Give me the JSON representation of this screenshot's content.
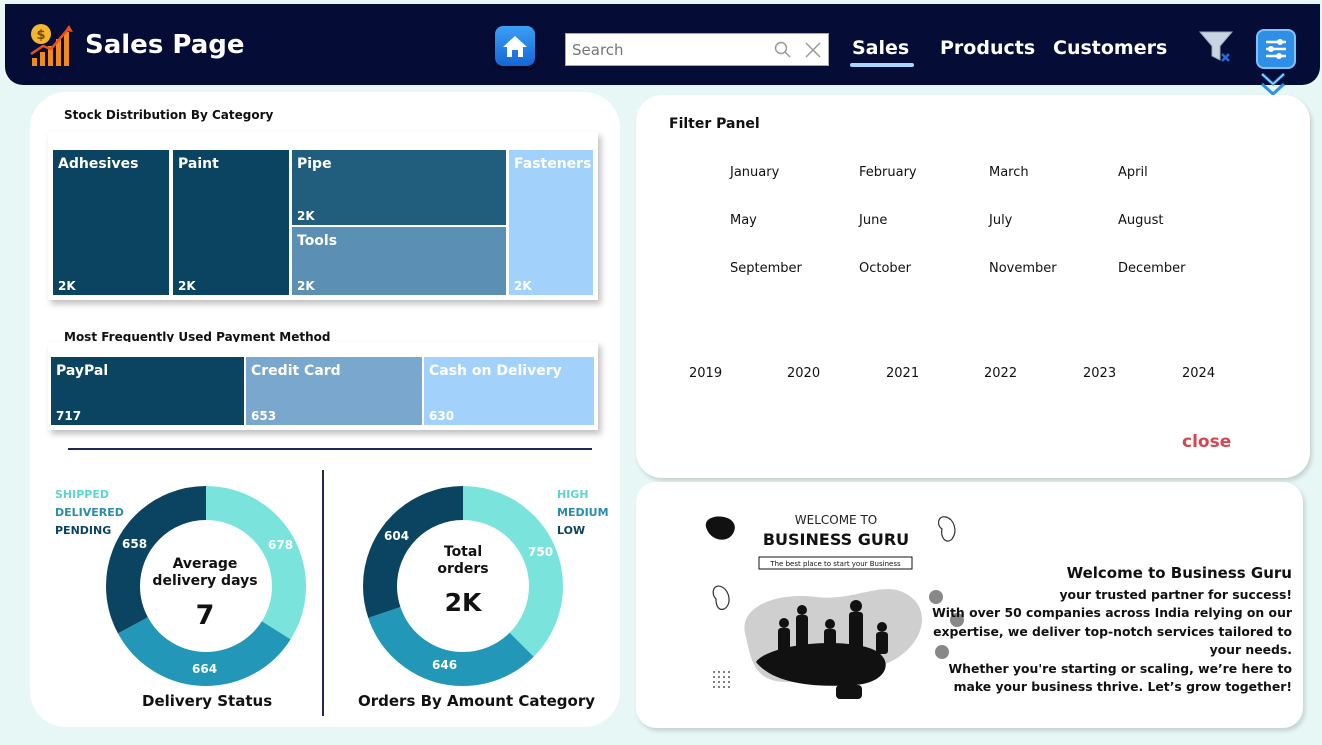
{
  "header": {
    "title": "Sales Page",
    "search_placeholder": "Search",
    "nav": [
      "Sales",
      "Products",
      "Customers"
    ],
    "active_nav": "Sales"
  },
  "stock_distribution": {
    "title": "Stock Distribution By Category",
    "tiles": [
      {
        "name": "Adhesives",
        "value": "2K"
      },
      {
        "name": "Paint",
        "value": "2K"
      },
      {
        "name": "Pipe",
        "value": "2K"
      },
      {
        "name": "Tools",
        "value": "2K"
      },
      {
        "name": "Fasteners",
        "value": "2K"
      }
    ]
  },
  "payment_methods": {
    "title": "Most Frequently Used Payment Method",
    "tiles": [
      {
        "name": "PayPal",
        "value": "717"
      },
      {
        "name": "Credit Card",
        "value": "653"
      },
      {
        "name": "Cash on Delivery",
        "value": "630"
      }
    ]
  },
  "delivery_status": {
    "caption": "Delivery Status",
    "center_label_1": "Average",
    "center_label_2": "delivery days",
    "center_value": "7",
    "legend": [
      "SHIPPED",
      "DELIVERED",
      "PENDING"
    ],
    "labels": [
      "678",
      "664",
      "658"
    ]
  },
  "orders_by_amount": {
    "caption": "Orders By Amount Category",
    "center_label_1": "Total",
    "center_label_2": "orders",
    "center_value": "2K",
    "legend": [
      "HIGH",
      "MEDIUM",
      "LOW"
    ],
    "labels": [
      "750",
      "646",
      "604"
    ]
  },
  "colors": {
    "navy": "#050c36",
    "dark_teal": "#0b4460",
    "mid_teal": "#2b8db0",
    "light_teal": "#79e3dc",
    "light_blue": "#9dcff8",
    "accent_red": "#d64550"
  },
  "filter_panel": {
    "title": "Filter Panel",
    "months": [
      "January",
      "February",
      "March",
      "April",
      "May",
      "June",
      "July",
      "August",
      "September",
      "October",
      "November",
      "December"
    ],
    "years": [
      "2019",
      "2020",
      "2021",
      "2022",
      "2023",
      "2024"
    ],
    "close_label": "close"
  },
  "welcome": {
    "art_heading_small": "WELCOME TO",
    "art_heading_big": "BUSINESS GURU",
    "art_tagline": "The best place to start your Business",
    "title": "Welcome to Business Guru",
    "lines": [
      "your trusted partner for success!",
      "With over 50 companies across India relying on our",
      "expertise, we deliver top-notch services tailored to",
      "your needs.",
      "Whether you're starting or scaling, we’re here to",
      "make your business thrive. Let’s grow together!"
    ]
  }
}
